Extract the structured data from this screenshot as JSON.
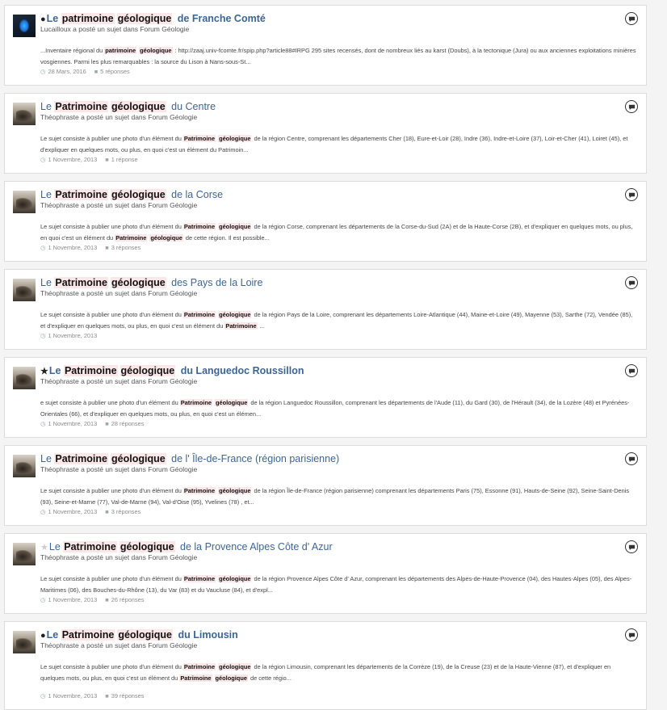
{
  "results": [
    {
      "prefix": "dot",
      "avatar": "blue",
      "bold": true,
      "title_pre": "Le",
      "title_hl1": "patrimoine",
      "title_hl2": "géologique",
      "title_post": "de Franche Comté",
      "meta": "Lucailloux a posté un sujet dans Forum Géologie",
      "snippet_parts": [
        {
          "t": "...Inventaire régional du "
        },
        {
          "h": "patrimoine"
        },
        {
          "h": "géologique"
        },
        {
          "t": ": http://zaaj.univ-fcomte.fr/spip.php?article88#IRPG 295 sites recensés, dont de nombreux liés au karst (Doubs), à la tectonique (Jura) ou aux anciennes exploitations minières vosgiennes. Parmi les plus remarquables : la source du Lison à Nans-sous-St..."
        }
      ],
      "date": "28 Mars, 2016",
      "replies": "5 réponses"
    },
    {
      "prefix": "",
      "avatar": "photo",
      "bold": false,
      "title_pre": "Le",
      "title_hl1": "Patrimoine",
      "title_hl2": "géologique",
      "title_post": "du Centre",
      "meta": "Théophraste a posté un sujet dans Forum Géologie",
      "snippet_parts": [
        {
          "t": "Le sujet consiste à publier une photo d'un élément du "
        },
        {
          "h": "Patrimoine"
        },
        {
          "h": "géologique"
        },
        {
          "t": "de la région Centre, comprenant les départements Cher (18), Eure-et-Loir (28), Indre (36), Indre-et-Loire (37), Loir-et-Cher (41), Loiret (45), et d'expliquer en quelques mots, ou plus, en quoi c'est un élément du Patrimoin..."
        }
      ],
      "date": "1 Novembre, 2013",
      "replies": "1 réponse"
    },
    {
      "prefix": "",
      "avatar": "photo",
      "bold": false,
      "title_pre": "Le",
      "title_hl1": "Patrimoine",
      "title_hl2": "géologique",
      "title_post": "de la Corse",
      "meta": "Théophraste a posté un sujet dans Forum Géologie",
      "snippet_parts": [
        {
          "t": "Le sujet consiste à publier une photo d'un élément du "
        },
        {
          "h": "Patrimoine"
        },
        {
          "h": "géologique"
        },
        {
          "t": "de la région Corse, comprenant les départements de la Corse-du-Sud (2A) et de la Haute-Corse (2B), et d'expliquer en quelques mots, ou plus, en quoi c'est un élément du "
        },
        {
          "h": "Patrimoine"
        },
        {
          "h": "géologique"
        },
        {
          "t": "de cette région. Il est possible..."
        }
      ],
      "date": "1 Novembre, 2013",
      "replies": "3 réponses"
    },
    {
      "prefix": "",
      "avatar": "photo",
      "bold": false,
      "title_pre": "Le",
      "title_hl1": "Patrimoine",
      "title_hl2": "géologique",
      "title_post": "des Pays de la Loire",
      "meta": "Théophraste a posté un sujet dans Forum Géologie",
      "snippet_parts": [
        {
          "t": "Le sujet consiste à publier une photo d'un élément du "
        },
        {
          "h": "Patrimoine"
        },
        {
          "h": "géologique"
        },
        {
          "t": "de la région Pays de la Loire, comprenant les départements Loire-Atlantique (44), Maine-et-Loire (49), Mayenne (53), Sarthe (72), Vendée (85), et d'expliquer en quelques mots, ou plus, en quoi c'est un élément du "
        },
        {
          "h": "Patrimoine"
        },
        {
          "t": "..."
        }
      ],
      "date": "1 Novembre, 2013",
      "replies": ""
    },
    {
      "prefix": "star",
      "avatar": "photo",
      "bold": true,
      "title_pre": "Le",
      "title_hl1": "Patrimoine",
      "title_hl2": "géologique",
      "title_post": "du Languedoc Roussillon",
      "meta": "Théophraste a posté un sujet dans Forum Géologie",
      "snippet_parts": [
        {
          "t": "e sujet consiste à publier une photo d'un élément du "
        },
        {
          "h": "Patrimoine"
        },
        {
          "h": "géologique"
        },
        {
          "t": "de la région Languedoc Roussillon, comprenant les départements de l'Aude (11), du Gard (30), de l'Hérault (34), de la Lozère (48) et Pyrénées-Orientales (66), et d'expliquer en quelques mots, ou plus, en quoi c'est un élémen..."
        }
      ],
      "date": "1 Novembre, 2013",
      "replies": "28 réponses"
    },
    {
      "prefix": "",
      "avatar": "photo",
      "bold": false,
      "title_pre": "Le",
      "title_hl1": "Patrimoine",
      "title_hl2": "géologique",
      "title_post": "de l' Île-de-France (région parisienne)",
      "meta": "Théophraste a posté un sujet dans Forum Géologie",
      "snippet_parts": [
        {
          "t": "Le sujet consiste à publier une photo d'un élément du "
        },
        {
          "h": "Patrimoine"
        },
        {
          "h": "géologique"
        },
        {
          "t": "de la région Île-de-France (région parisienne) comprenant les départements Paris (75), Essonne (91), Hauts-de-Seine (92), Seine-Saint-Denis (93), Seine-et-Marne (77), Val-de-Marne (94), Val-d'Oise (95), Yvelines (78) , et..."
        }
      ],
      "date": "1 Novembre, 2013",
      "replies": "3 réponses"
    },
    {
      "prefix": "star-empty",
      "avatar": "photo",
      "bold": false,
      "title_pre": "Le",
      "title_hl1": "Patrimoine",
      "title_hl2": "géologique",
      "title_post": "de la Provence Alpes Côte d' Azur",
      "meta": "Théophraste a posté un sujet dans Forum Géologie",
      "snippet_parts": [
        {
          "t": "Le sujet consiste à publier une photo d'un élément du "
        },
        {
          "h": "Patrimoine"
        },
        {
          "h": "géologique"
        },
        {
          "t": "de la région Provence Alpes Côte d' Azur, comprenant les départements des Alpes-de-Haute-Provence (04), des Hautes-Alpes (05), des Alpes-Maritimes (06), des Bouches-du-Rhône (13), du Var (83) et du Vaucluse (84), et d'expl..."
        }
      ],
      "date": "1 Novembre, 2013",
      "replies": "26 réponses"
    },
    {
      "prefix": "dot",
      "avatar": "photo",
      "bold": true,
      "title_pre": "Le",
      "title_hl1": "Patrimoine",
      "title_hl2": "géologique",
      "title_post": "du Limousin",
      "meta": "Théophraste a posté un sujet dans Forum Géologie",
      "snippet_parts": [
        {
          "t": "Le sujet consiste à publier une photo d'un élément du "
        },
        {
          "h": "Patrimoine"
        },
        {
          "h": "géologique"
        },
        {
          "t": "de la région Limousin, comprenant les départements de la Corrèze (19), de la Creuse (23) et de la Haute-Vienne (87), et d'expliquer en quelques mots, ou plus, en quoi c'est un élément du "
        },
        {
          "h": "Patrimoine"
        },
        {
          "h": "géologique"
        },
        {
          "t": "de cette régio..."
        }
      ],
      "date": "1 Novembre, 2013",
      "replies": "39 réponses"
    }
  ],
  "icons": {
    "date": "clock-icon",
    "replies": "comment-icon",
    "action": "chat-bubble-icon",
    "dot_glyph": "●",
    "star_glyph": "★",
    "clock_glyph": "◷",
    "reply_glyph": "💬"
  }
}
